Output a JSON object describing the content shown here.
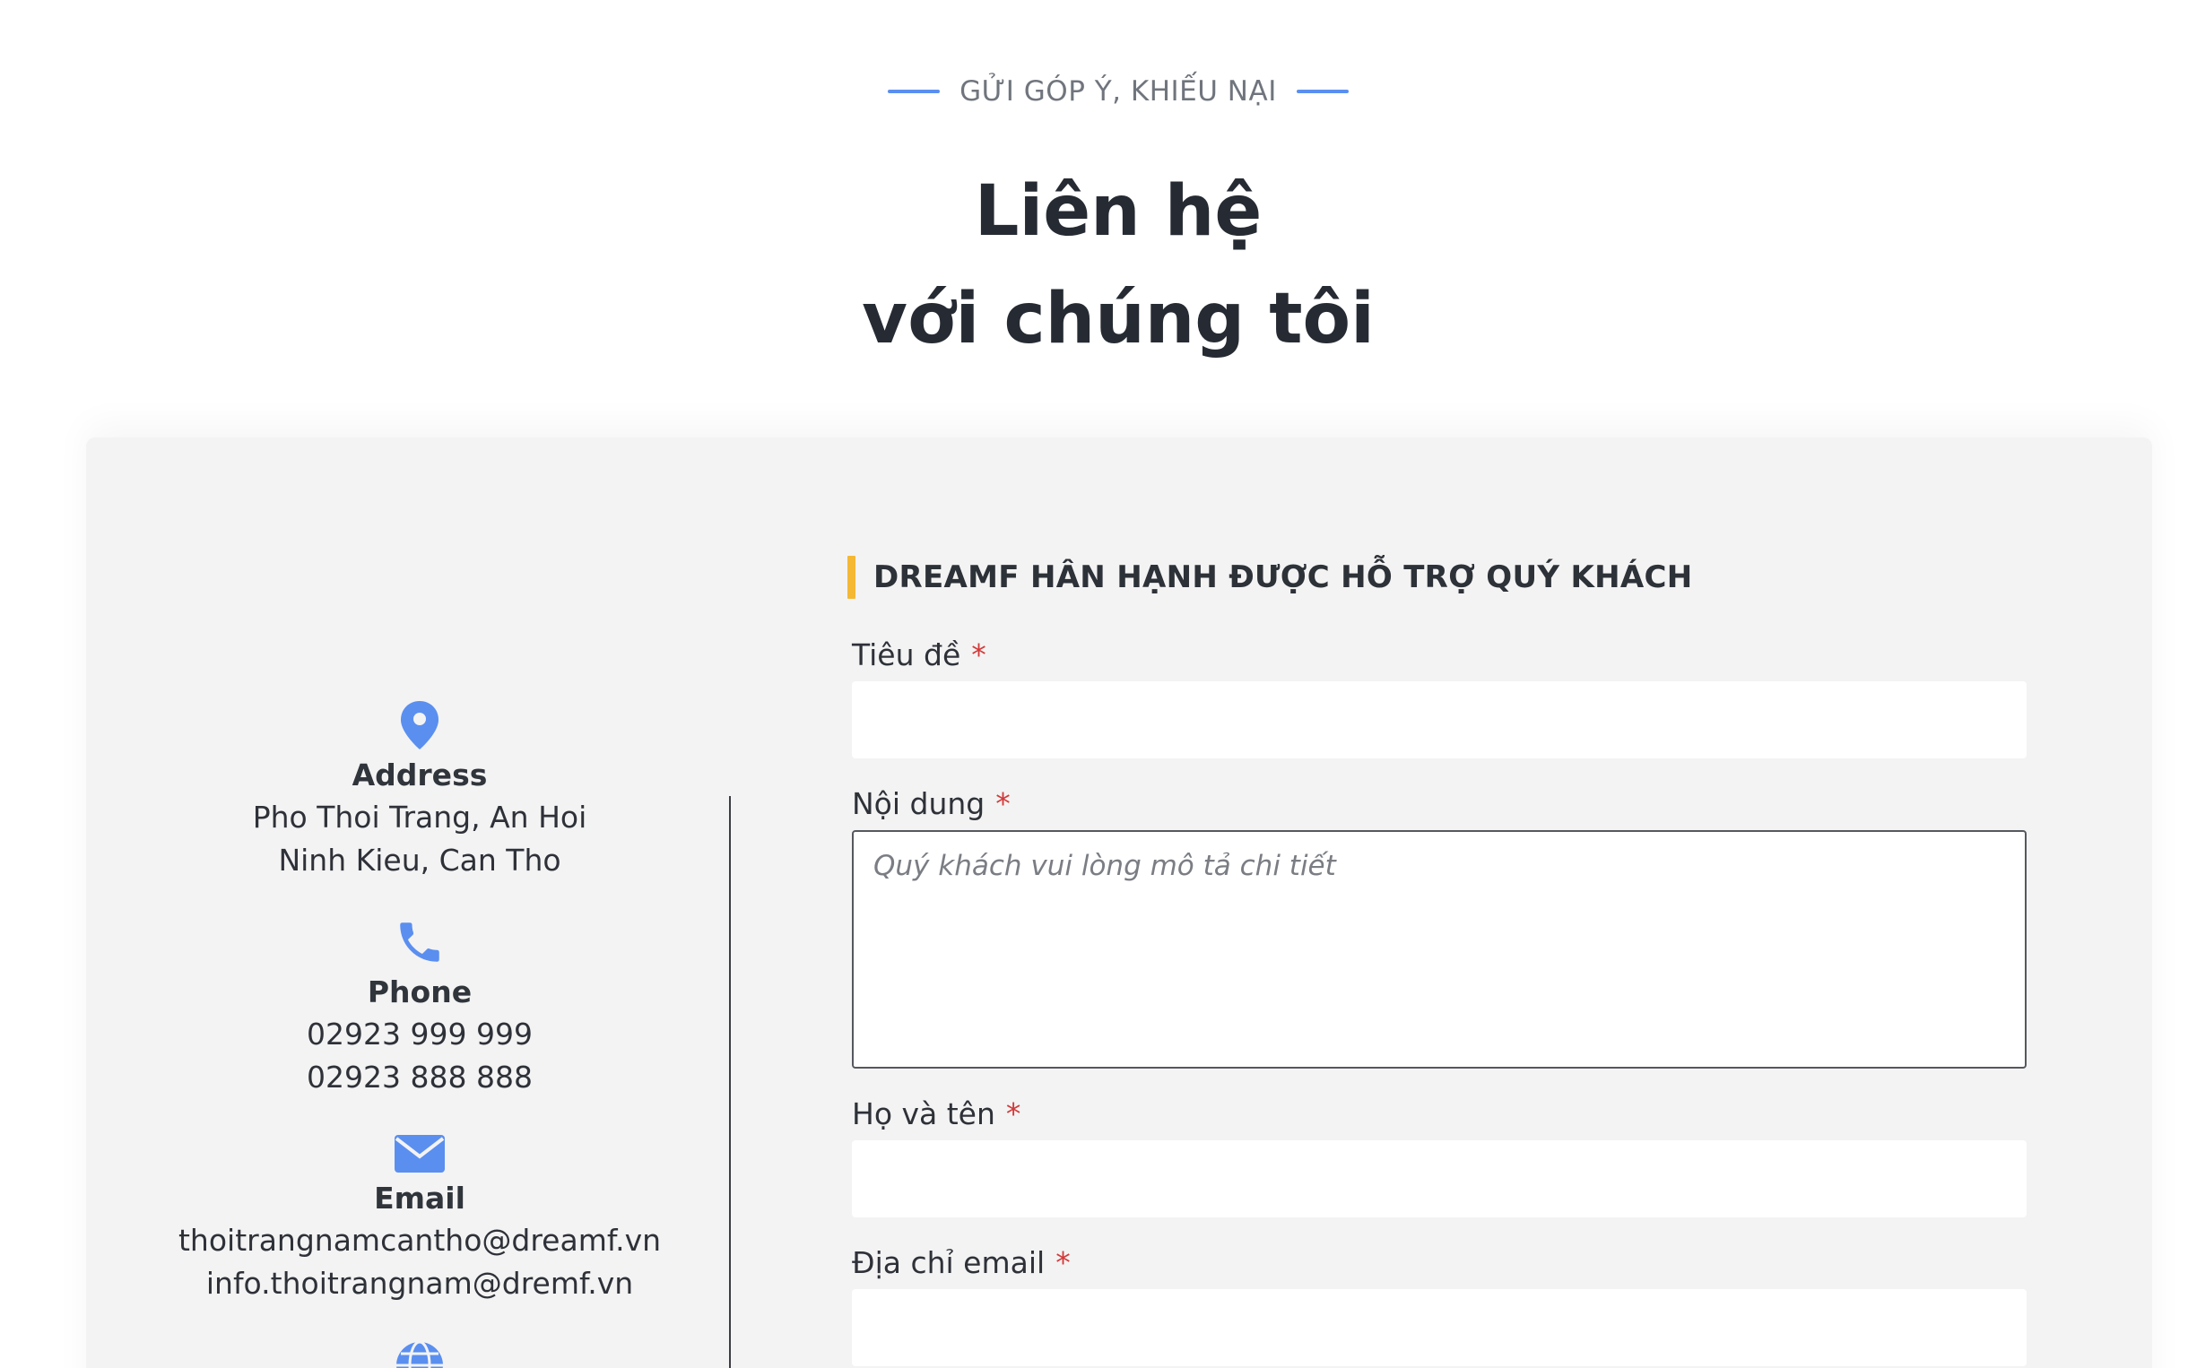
{
  "header": {
    "eyebrow": "GỬI GÓP Ý, KHIẾU NẠI",
    "title_line1": "Liên hệ",
    "title_line2": "với chúng tôi"
  },
  "contact": {
    "address": {
      "icon": "map-pin-icon",
      "title": "Address",
      "line1": "Pho Thoi Trang, An Hoi",
      "line2": "Ninh Kieu, Can Tho"
    },
    "phone": {
      "icon": "phone-icon",
      "title": "Phone",
      "line1": "02923 999 999",
      "line2": "02923 888 888"
    },
    "email": {
      "icon": "envelope-icon",
      "title": "Email",
      "line1": "thoitrangnamcantho@dreamf.vn",
      "line2": "info.thoitrangnam@dremf.vn"
    },
    "website_icon": "globe-icon"
  },
  "form": {
    "heading": "DREAMF HÂN HẠNH ĐƯỢC HỖ TRỢ QUÝ KHÁCH",
    "required_mark": "*",
    "subject_label": "Tiêu đề",
    "subject_value": "",
    "content_label": "Nội dung",
    "content_placeholder": "Quý khách vui lòng mô tả chi tiết",
    "name_label": "Họ và tên",
    "name_value": "",
    "email_label": "Địa chỉ email",
    "email_value": ""
  },
  "colors": {
    "accent_blue": "#5a8ff0",
    "accent_yellow": "#f5b834",
    "required_red": "#d23a3a",
    "card_bg": "#f3f3f3"
  }
}
